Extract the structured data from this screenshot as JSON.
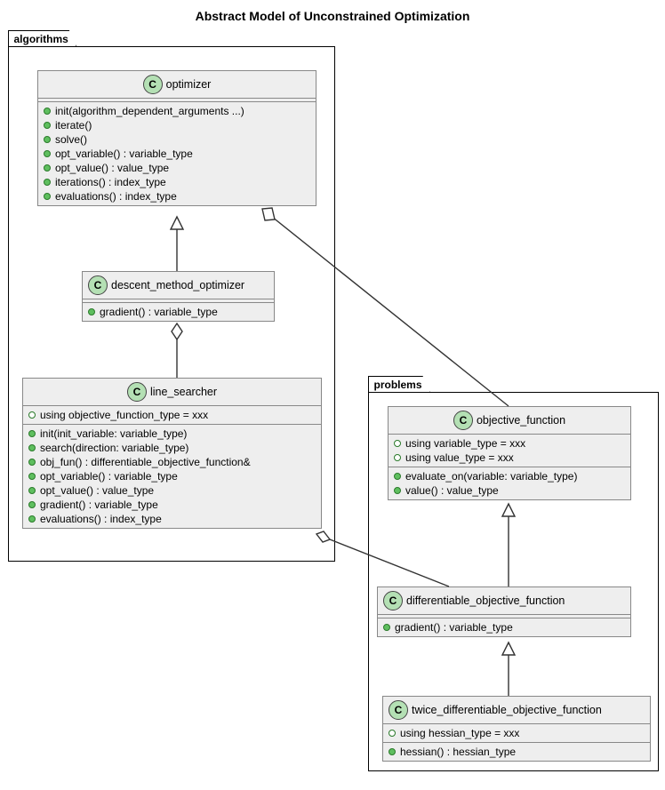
{
  "title": "Abstract Model of Unconstrained Optimization",
  "packages": {
    "algorithms": {
      "label": "algorithms"
    },
    "problems": {
      "label": "problems"
    }
  },
  "classes": {
    "optimizer": {
      "name": "optimizer",
      "members": [
        "init(algorithm_dependent_arguments ...)",
        "iterate()",
        "solve()",
        "opt_variable() : variable_type",
        "opt_value() : value_type",
        "iterations() : index_type",
        "evaluations() : index_type"
      ]
    },
    "descent": {
      "name": "descent_method_optimizer",
      "members": [
        "gradient() : variable_type"
      ]
    },
    "line_searcher": {
      "name": "line_searcher",
      "usings": [
        "using objective_function_type = xxx"
      ],
      "members": [
        "init(init_variable: variable_type)",
        "search(direction: variable_type)",
        "obj_fun() : differentiable_objective_function&",
        "opt_variable() : variable_type",
        "opt_value() : value_type",
        "gradient() : variable_type",
        "evaluations() : index_type"
      ]
    },
    "obj_fun": {
      "name": "objective_function",
      "usings": [
        "using variable_type = xxx",
        "using value_type = xxx"
      ],
      "members": [
        "evaluate_on(variable: variable_type)",
        "value() : value_type"
      ]
    },
    "diff_obj": {
      "name": "differentiable_objective_function",
      "members": [
        "gradient() : variable_type"
      ]
    },
    "twice_diff": {
      "name": "twice_differentiable_objective_function",
      "usings": [
        "using hessian_type = xxx"
      ],
      "members": [
        "hessian() : hessian_type"
      ]
    }
  },
  "icon_letter": "C"
}
